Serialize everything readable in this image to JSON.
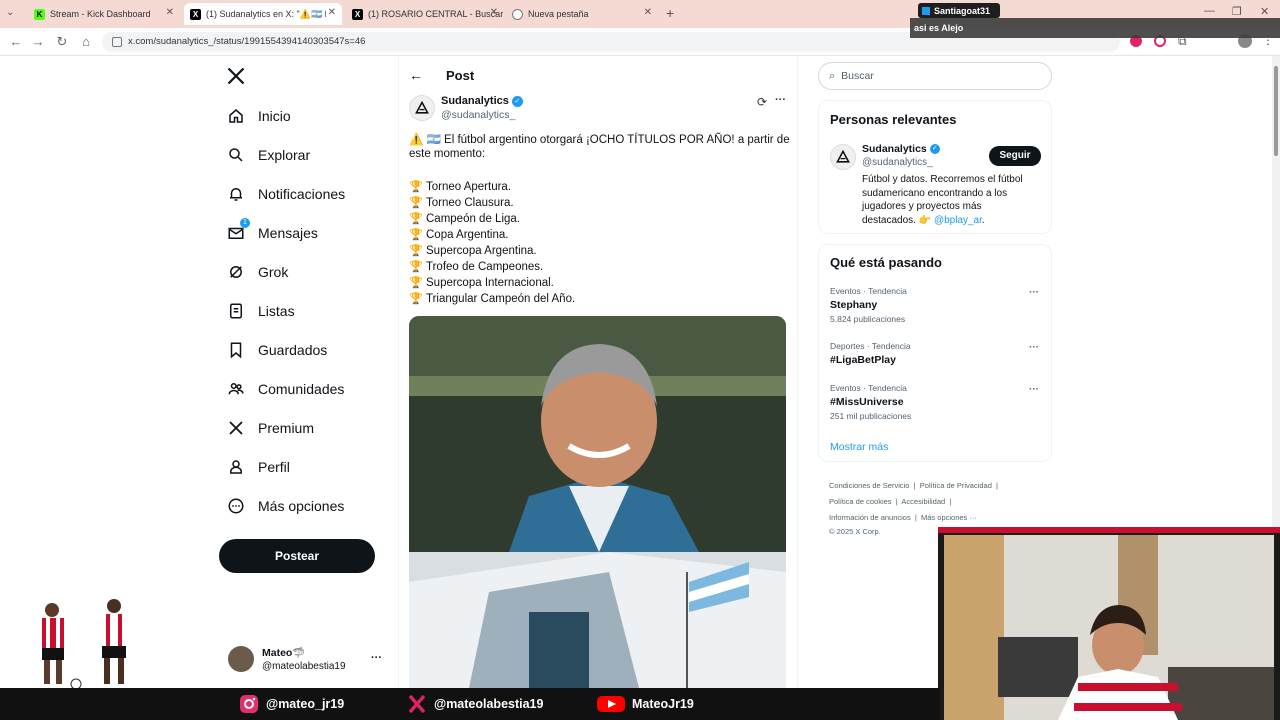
{
  "browser": {
    "tabs": [
      {
        "title": "Stream - Kick Dashboard",
        "favicon": "kick-icon",
        "color": "#53fc18"
      },
      {
        "title": "(1) Sudanalytics en X: \"⚠️🇦🇷 El f",
        "favicon": "x-icon",
        "color": "#000000"
      },
      {
        "title": "(1) ROSARIO CENTRAL - Buscar",
        "favicon": "x-icon",
        "color": "#000000"
      },
      {
        "title": "Nueva pestaña",
        "favicon": "chrome-icon",
        "color": "#555555"
      }
    ],
    "new_tab": "+",
    "url": "x.com/sudanalytics_/status/1991554394140303547s=46"
  },
  "stream_overlay": {
    "username": "Santiagoat31",
    "message": "asi es Alejo",
    "socials": [
      {
        "icon": "instagram-icon",
        "handle": "@mateo_jr19"
      },
      {
        "icon": "x-logo-icon",
        "handle": "@mateolabestia19"
      },
      {
        "icon": "youtube-icon",
        "handle": "MateoJr19"
      }
    ]
  },
  "nav": {
    "items": [
      {
        "label": "Inicio",
        "icon": "home-icon"
      },
      {
        "label": "Explorar",
        "icon": "search-icon"
      },
      {
        "label": "Notificaciones",
        "icon": "bell-icon"
      },
      {
        "label": "Mensajes",
        "icon": "mail-icon",
        "badge": "1"
      },
      {
        "label": "Grok",
        "icon": "grok-icon"
      },
      {
        "label": "Listas",
        "icon": "list-icon"
      },
      {
        "label": "Guardados",
        "icon": "bookmark-icon"
      },
      {
        "label": "Comunidades",
        "icon": "communities-icon"
      },
      {
        "label": "Premium",
        "icon": "x-logo-icon"
      },
      {
        "label": "Perfil",
        "icon": "person-icon"
      },
      {
        "label": "Más opciones",
        "icon": "more-circle-icon"
      }
    ],
    "post_button": "Postear",
    "account": {
      "name": "Mateo🦈",
      "handle": "@mateolabestia19",
      "more": "···"
    }
  },
  "post": {
    "header": "Post",
    "author": {
      "name": "Sudanalytics",
      "handle": "@sudanalytics_"
    },
    "intro_1": "⚠️ 🇦🇷 El fútbol argentino otorgará ¡OCHO TÍTULOS POR AÑO! a partir de",
    "intro_2": "este momento:",
    "titles": [
      "Torneo Apertura.",
      "Torneo Clausura.",
      "Campeón de Liga.",
      "Copa Argentina.",
      "Supercopa Argentina.",
      "Trofeo de Campeones.",
      "Supercopa Internacional.",
      "Triangular Campeón del Año."
    ]
  },
  "sidebar": {
    "search_placeholder": "Buscar",
    "relevant": {
      "title": "Personas relevantes",
      "name": "Sudanalytics",
      "handle": "@sudanalytics_",
      "follow": "Seguir",
      "bio_1": "Fútbol y datos. Recorremos el fútbol",
      "bio_2": "sudamericano encontrando a los",
      "bio_3": "jugadores y proyectos más",
      "bio_4": "destacados. 👉",
      "bio_link": "@bplay_ar",
      "bio_end": "."
    },
    "trending": {
      "title": "Qué está pasando",
      "items": [
        {
          "context": "Eventos · Tendencia",
          "topic": "Stephany",
          "count": "5.824 publicaciones"
        },
        {
          "context": "Deportes · Tendencia",
          "topic": "#LigaBetPlay",
          "count": ""
        },
        {
          "context": "Eventos · Tendencia",
          "topic": "#MissUniverse",
          "count": "251 mil publicaciones"
        }
      ],
      "show_more": "Mostrar más"
    },
    "footer": {
      "links": [
        "Condiciones de Servicio",
        "Política de Privacidad",
        "Política de cookies",
        "Accesibilidad",
        "Información de anuncios",
        "Más opciones ···"
      ],
      "copyright": "© 2025 X Corp."
    }
  }
}
